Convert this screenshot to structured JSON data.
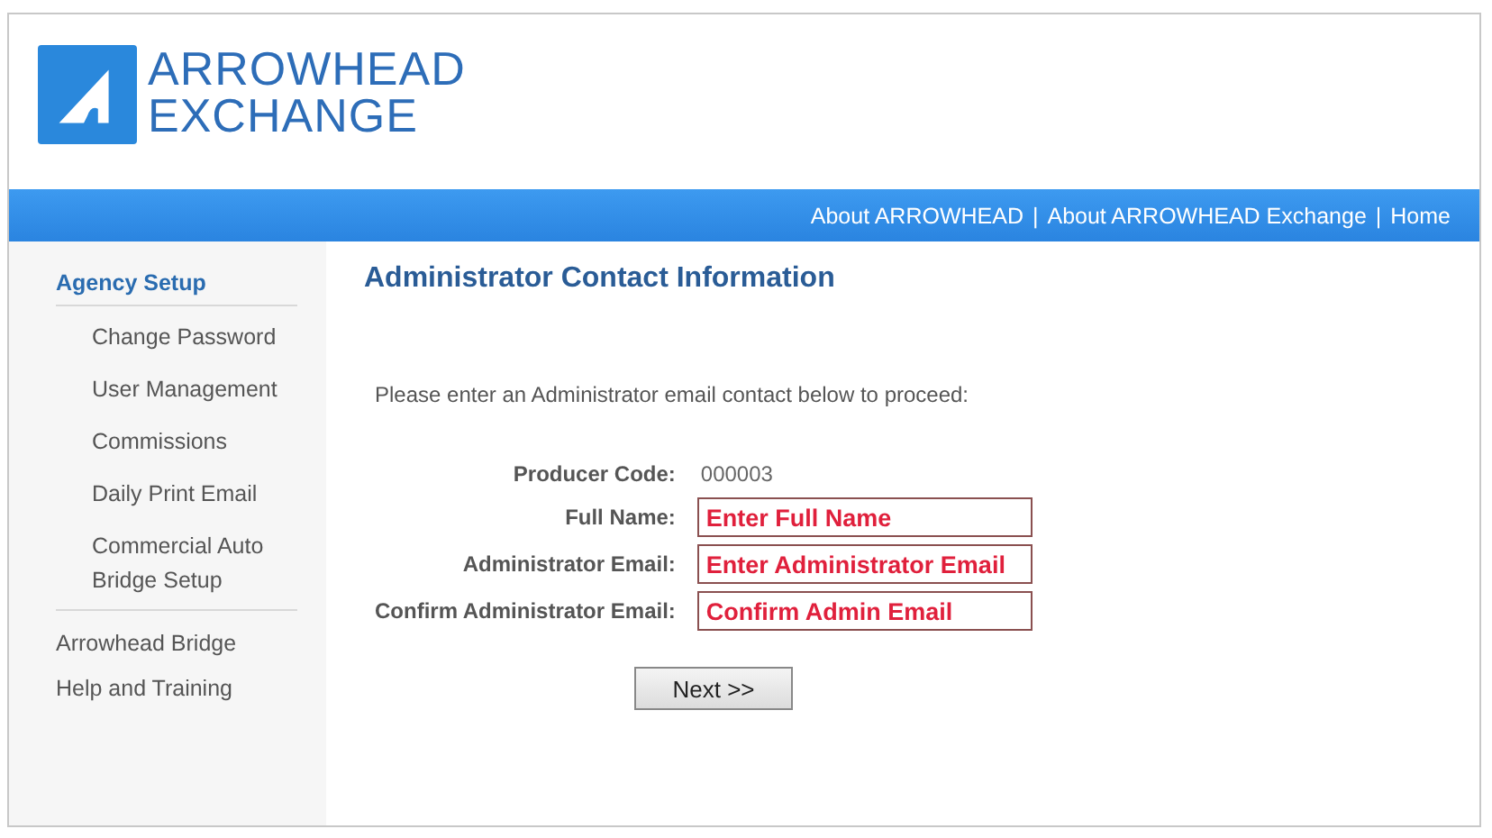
{
  "logo": {
    "line_1": "ARROWHEAD",
    "line_2": "EXCHANGE"
  },
  "nav": {
    "links": [
      "About ARROWHEAD",
      "About ARROWHEAD Exchange",
      "Home"
    ],
    "separator": "|"
  },
  "sidebar": {
    "section": "Agency Setup",
    "items": [
      {
        "label": "Change Password"
      },
      {
        "label": "User Management"
      },
      {
        "label": "Commissions"
      },
      {
        "label": "Daily Print Email"
      },
      {
        "label": "Commercial Auto Bridge Setup"
      }
    ],
    "links": [
      "Arrowhead Bridge",
      "Help and Training"
    ]
  },
  "main": {
    "title": "Administrator Contact Information",
    "instruction": "Please enter an Administrator email contact below to proceed:",
    "producer": {
      "label": "Producer Code:",
      "value": "000003"
    },
    "fields": [
      {
        "label": "Full Name:",
        "value": "Enter Full Name"
      },
      {
        "label": "Administrator Email:",
        "value": "Enter Administrator Email"
      },
      {
        "label": "Confirm Administrator Email:",
        "value": "Confirm Admin Email"
      }
    ],
    "button": "Next >>"
  }
}
